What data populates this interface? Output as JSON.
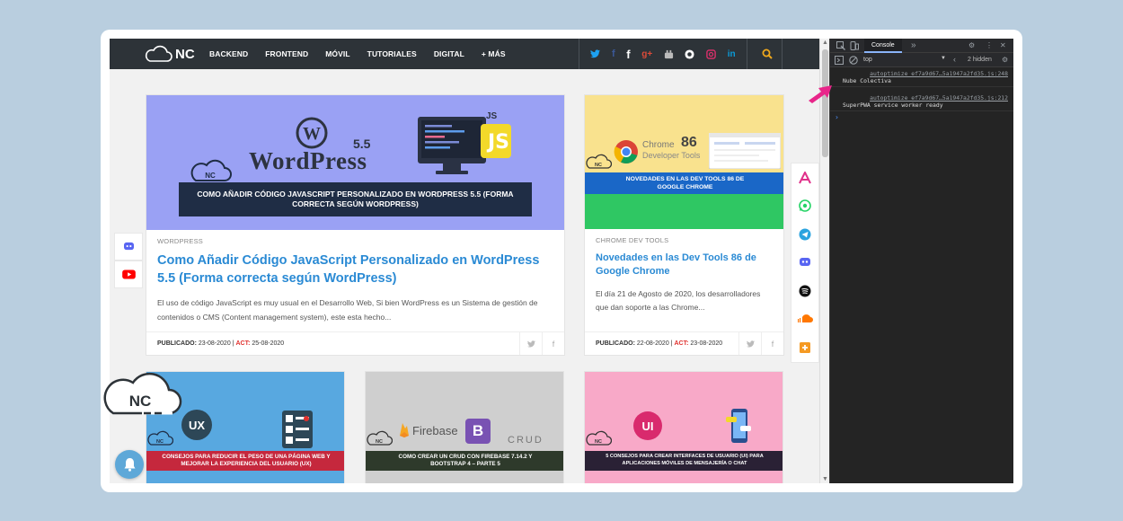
{
  "nav": {
    "logo_text": "NC",
    "menu": [
      "BACKEND",
      "FRONTEND",
      "MÓVIL",
      "TUTORIALES",
      "DIGITAL",
      "+ MÁS"
    ],
    "social_icons": [
      "twitter-icon",
      "facebook-icon",
      "facebook-f-icon",
      "google-plus-icon",
      "youtube-icon",
      "github-icon",
      "instagram-icon",
      "linkedin-icon"
    ],
    "accent": "#f0a81c"
  },
  "featured": {
    "image_brand": "WordPress",
    "image_version": "5.5",
    "image_badge": "JS",
    "image_banner": "COMO AÑADIR CÓDIGO JAVASCRIPT PERSONALIZADO EN WORDPRESS 5.5 (FORMA CORRECTA SEGÚN WORDPRESS)",
    "image_logo": "NC",
    "category": "WORDPRESS",
    "title": "Como Añadir Código JavaScript Personalizado en WordPress 5.5 (Forma correcta según WordPress)",
    "excerpt": "El uso de código JavaScript es muy usual en el Desarrollo Web, Si bien WordPress es un Sistema de gestión de contenidos o CMS (Content management system), este esta hecho...",
    "published_label": "PUBLICADO:",
    "published": "23-08-2020",
    "sep": "|",
    "updated_label": "ACT:",
    "updated": "25-08-2020"
  },
  "chrome_card": {
    "image_text1": "Chrome",
    "image_text2": "Developer Tools",
    "image_number": "86",
    "image_banner": "NOVEDADES EN LAS DEV TOOLS 86 DE GOOGLE CHROME",
    "image_logo": "NC",
    "category": "CHROME DEV TOOLS",
    "title": "Novedades en las Dev Tools 86 de Google Chrome",
    "excerpt": "El día 21 de Agosto de 2020, los desarrolladores que dan soporte a las Chrome...",
    "published_label": "PUBLICADO:",
    "published": "22-08-2020",
    "sep": "|",
    "updated_label": "ACT:",
    "updated": "23-08-2020"
  },
  "row2": [
    {
      "badge": "UX",
      "logo": "NC",
      "banner": "CONSEJOS PARA REDUCIR EL PESO DE UNA PÁGINA WEB Y MEJORAR LA EXPERIENCIA DEL USUARIO (UX)",
      "bg": "#58a8e0"
    },
    {
      "badge": "Firebase",
      "badge2": "B",
      "crud": "CRUD",
      "logo": "NC",
      "banner": "COMO CREAR UN CRUD CON FIREBASE 7.14.2 Y BOOTSTRAP 4 – PARTE 5",
      "bg": "#cfcfcf"
    },
    {
      "badge": "UI",
      "logo": "NC",
      "banner": "5 CONSEJOS PARA CREAR INTERFACES DE USUARIO (UI) PARA APLICACIONES MÓVILES DE MENSAJERÍA O CHAT",
      "bg": "#f8a9c8"
    }
  ],
  "left_share": [
    "discord-icon",
    "youtube-icon"
  ],
  "right_share": [
    "alpha-icon",
    "whatsapp-icon",
    "telegram-icon",
    "discord-icon",
    "spotify-icon",
    "soundcloud-icon",
    "bookmark-plus-icon"
  ],
  "brand_overlay": "NC",
  "devtools": {
    "tab": "Console",
    "context": "top",
    "hidden": "2 hidden",
    "logs": [
      {
        "source": "autoptimize_ef7a9d67…5a1947a2fd35.js:248",
        "message": "Nube Colectiva"
      },
      {
        "source": "autoptimize_ef7a9d67…5a1947a2fd35.js:212",
        "message": "SuperPWA service worker ready"
      }
    ],
    "prompt": "›"
  }
}
